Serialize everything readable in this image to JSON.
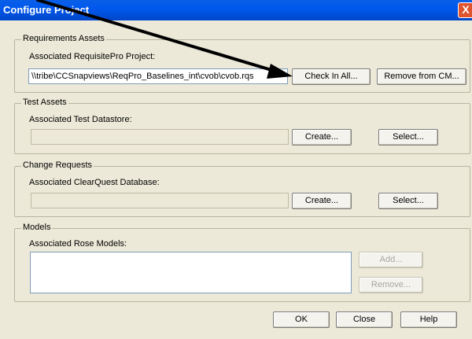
{
  "window": {
    "title": "Configure Project",
    "close_glyph": "X"
  },
  "requirements": {
    "legend": "Requirements Assets",
    "label": "Associated RequisitePro Project:",
    "path": "\\\\tribe\\CCSnapviews\\ReqPro_Baselines_int\\cvob\\cvob.rqs",
    "check_in_label": "Check In All...",
    "remove_label": "Remove from CM..."
  },
  "test": {
    "legend": "Test Assets",
    "label": "Associated Test Datastore:",
    "value": "",
    "create_label": "Create...",
    "select_label": "Select..."
  },
  "change": {
    "legend": "Change Requests",
    "label": "Associated ClearQuest Database:",
    "value": "",
    "create_label": "Create...",
    "select_label": "Select..."
  },
  "models": {
    "legend": "Models",
    "label": "Associated Rose Models:",
    "add_label": "Add...",
    "remove_label": "Remove..."
  },
  "footer": {
    "ok_label": "OK",
    "close_label": "Close",
    "help_label": "Help"
  },
  "annotation": {
    "arrow_color": "#000000",
    "icon": "pointer-arrow"
  }
}
